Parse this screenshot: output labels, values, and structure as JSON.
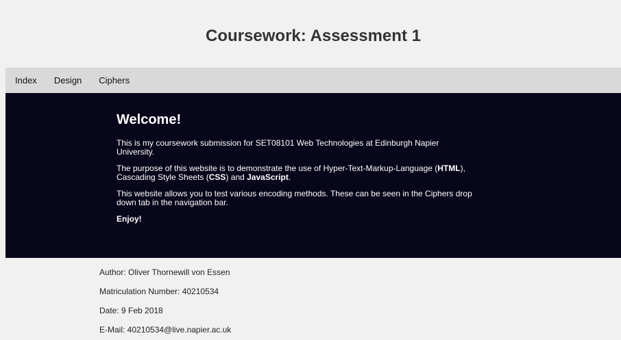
{
  "header": {
    "title": "Coursework: Assessment 1"
  },
  "nav": {
    "items": [
      {
        "label": "Index"
      },
      {
        "label": "Design"
      },
      {
        "label": "Ciphers"
      }
    ]
  },
  "main": {
    "heading": "Welcome!",
    "p1": "This is my coursework submission for SET08101 Web Technologies at Edinburgh Napier University.",
    "p2_a": "The purpose of this website is to demonstrate the use of Hyper-Text-Markup-Language (",
    "p2_html": "HTML",
    "p2_b": "), Cascading Style Sheets (",
    "p2_css": "CSS",
    "p2_c": ") and ",
    "p2_js": "JavaScript",
    "p2_d": ".",
    "p3": "This website allows you to test various encoding methods. These can be seen in the Ciphers drop down tab in the navigation bar.",
    "enjoy": "Enjoy!"
  },
  "footer": {
    "author": "Author: Oliver Thornewill von Essen",
    "matric": "Matriculation Number: 40210534",
    "date": "Date: 9 Feb 2018",
    "email": "E-Mail: 40210534@live.napier.ac.uk"
  }
}
